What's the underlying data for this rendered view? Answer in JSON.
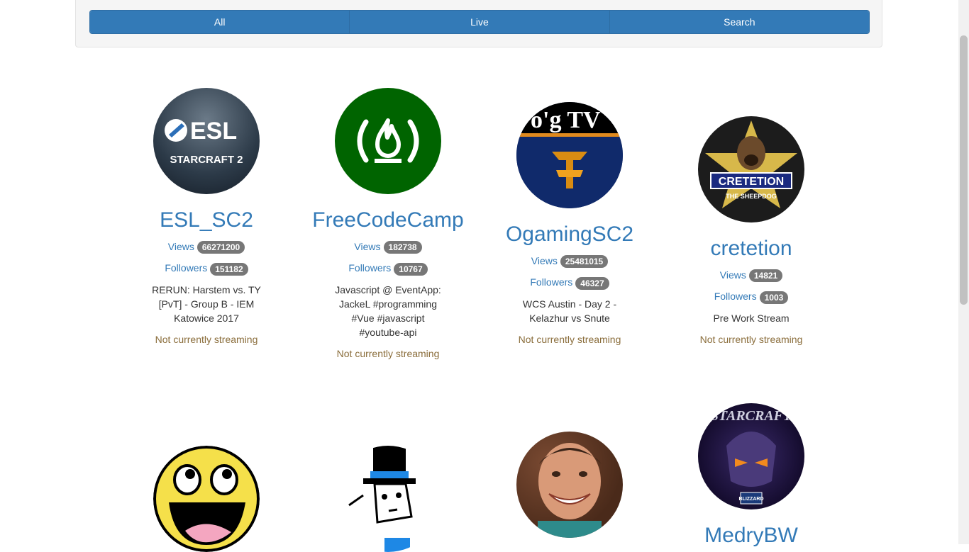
{
  "nav": {
    "all_label": "All",
    "live_label": "Live",
    "search_label": "Search"
  },
  "cards": [
    {
      "name": "ESL_SC2",
      "views_label": "Views",
      "views": "66271200",
      "followers_label": "Followers",
      "followers": "151182",
      "status": "RERUN: Harstem vs. TY [PvT] - Group B - IEM Katowice 2017",
      "stream_state": "Not currently streaming",
      "logo_text_top": "ESL",
      "logo_text_bottom": "STARCRAFT 2"
    },
    {
      "name": "FreeCodeCamp",
      "views_label": "Views",
      "views": "182738",
      "followers_label": "Followers",
      "followers": "10767",
      "status": "Javascript @ EventApp: JackeL #programming #Vue #javascript #youtube-api",
      "stream_state": "Not currently streaming"
    },
    {
      "name": "OgamingSC2",
      "views_label": "Views",
      "views": "25481015",
      "followers_label": "Followers",
      "followers": "46327",
      "status": "WCS Austin - Day 2 - Kelazhur vs Snute",
      "stream_state": "Not currently streaming",
      "logo_text": "o'g TV"
    },
    {
      "name": "cretetion",
      "views_label": "Views",
      "views": "14821",
      "followers_label": "Followers",
      "followers": "1003",
      "status": "Pre Work Stream",
      "stream_state": "Not currently streaming",
      "logo_text_top": "CRETETION",
      "logo_text_bottom": "THE SHEEPDOG"
    },
    {
      "name": ""
    },
    {
      "name": ""
    },
    {
      "name": ""
    },
    {
      "name": "MedryBW",
      "logo_text_top": "STARCRAFT",
      "logo_text_bottom": "BLIZZARD"
    }
  ],
  "colors": {
    "primary": "#337ab7",
    "badge": "#777777",
    "offline": "#8a6d3b"
  }
}
